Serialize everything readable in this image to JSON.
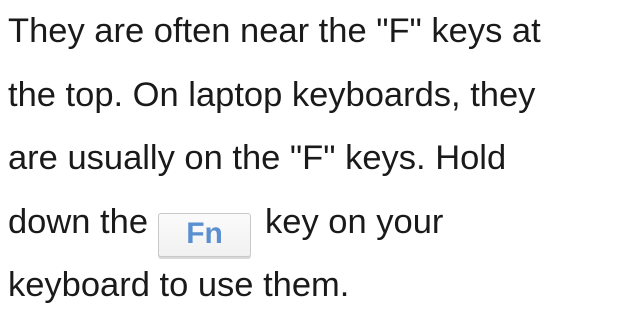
{
  "paragraph": {
    "line1": "They are often near the \"F\" keys at",
    "line2": "the top. On laptop keyboards, they",
    "line3": "are usually on the \"F\" keys. Hold",
    "line4_before": "down the",
    "key_label": "Fn",
    "line4_after": "key on your",
    "line5": "keyboard to use them."
  },
  "colors": {
    "text": "#1a1a1a",
    "key_label": "#5b8fcf",
    "key_border": "#c8c8c8",
    "background": "#ffffff"
  }
}
